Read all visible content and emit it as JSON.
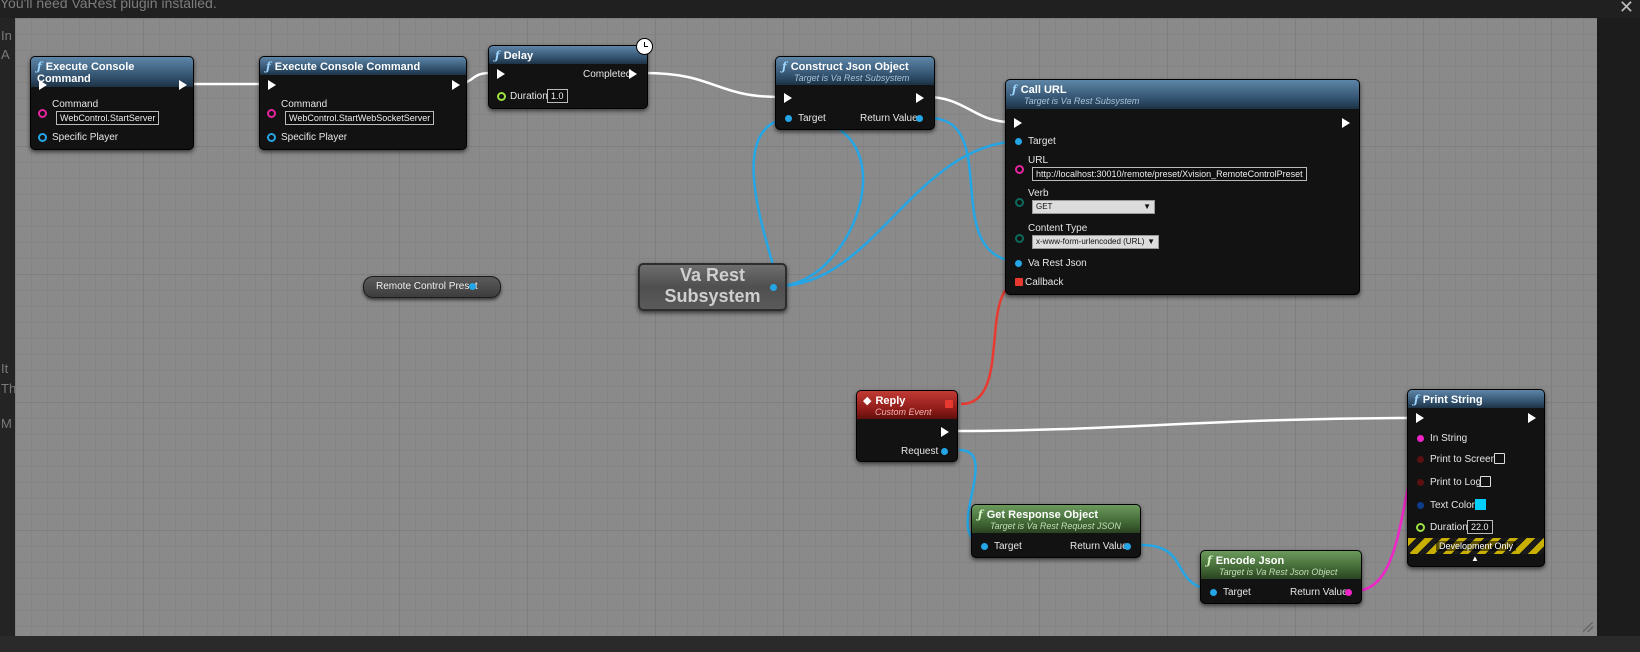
{
  "top_message": "You'll need VaRest plugin installed.",
  "left_fragments": [
    "In",
    "A",
    "It",
    "Th",
    "M"
  ],
  "nodes": {
    "exec1": {
      "title": "Execute Console Command",
      "command_label": "Command",
      "command_value": "WebControl.StartServer",
      "player_label": "Specific Player"
    },
    "exec2": {
      "title": "Execute Console Command",
      "command_label": "Command",
      "command_value": "WebControl.StartWebSocketServer",
      "player_label": "Specific Player"
    },
    "delay": {
      "title": "Delay",
      "completed_label": "Completed",
      "duration_label": "Duration",
      "duration_value": "1.0"
    },
    "construct_json": {
      "title": "Construct Json Object",
      "subtitle": "Target is Va Rest Subsystem",
      "target_label": "Target",
      "return_label": "Return Value"
    },
    "call_url": {
      "title": "Call URL",
      "subtitle": "Target is Va Rest Subsystem",
      "target_label": "Target",
      "url_label": "URL",
      "url_value": "http://localhost:30010/remote/preset/Xvision_RemoteControlPreset",
      "verb_label": "Verb",
      "verb_value": "GET",
      "content_type_label": "Content Type",
      "content_type_value": "x-www-form-urlencoded (URL)",
      "json_label": "Va Rest Json",
      "callback_label": "Callback"
    },
    "remote_preset": {
      "label": "Remote Control Preset"
    },
    "va_rest": {
      "line1": "Va Rest",
      "line2": "Subsystem"
    },
    "reply": {
      "title": "Reply",
      "subtitle": "Custom Event",
      "request_label": "Request"
    },
    "get_response": {
      "title": "Get Response Object",
      "subtitle": "Target is Va Rest Request JSON",
      "target_label": "Target",
      "return_label": "Return Value"
    },
    "encode_json": {
      "title": "Encode Json",
      "subtitle": "Target is Va Rest Json Object",
      "target_label": "Target",
      "return_label": "Return Value"
    },
    "print_string": {
      "title": "Print String",
      "in_string_label": "In String",
      "print_screen_label": "Print to Screen",
      "print_log_label": "Print to Log",
      "text_color_label": "Text Color",
      "text_color_value": "#00cfff",
      "duration_label": "Duration",
      "duration_value": "22.0",
      "dev_label": "Development Only"
    }
  },
  "icons": {
    "function": "ƒ",
    "event": "◆",
    "close": "✕"
  },
  "colors": {
    "exec_wire": "#ffffff",
    "object_wire": "#24a6e6",
    "string_wire": "#f024c8",
    "delegate_wire": "#e83a30",
    "canvas": "#8a8a8a"
  }
}
